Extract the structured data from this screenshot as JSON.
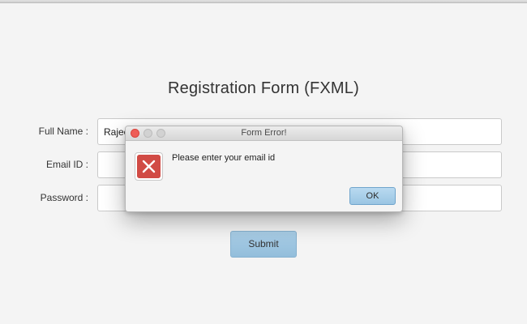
{
  "form": {
    "title": "Registration Form (FXML)",
    "fields": [
      {
        "label": "Full Name :",
        "value": "Rajee",
        "placeholder": ""
      },
      {
        "label": "Email ID :",
        "value": "",
        "placeholder": ""
      },
      {
        "label": "Password :",
        "value": "",
        "placeholder": ""
      }
    ],
    "submit_label": "Submit"
  },
  "dialog": {
    "title": "Form Error!",
    "message": "Please enter your email id",
    "ok_label": "OK",
    "icon": "error-x-icon"
  },
  "colors": {
    "accent_button": "#9ac5e3",
    "error_red": "#d14b45",
    "close_dot": "#ee5d57"
  }
}
